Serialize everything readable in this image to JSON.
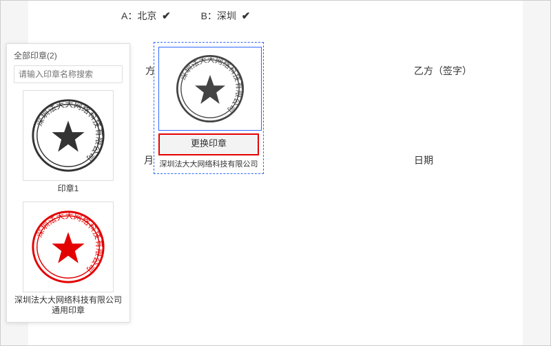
{
  "doc": {
    "optA": "A：北京",
    "optB": "B：深圳",
    "check": "✔",
    "leftMarker": "方",
    "leftDateMarker": "月",
    "partyB": "乙方（签字）",
    "dateLabel": "日期"
  },
  "sealBox": {
    "company": "深圳法大大网络科技有限公司",
    "changeLabel": "更换印章",
    "caption": "深圳法大大网络科技有限公司"
  },
  "panel": {
    "title": "全部印章",
    "count": "2",
    "searchPlaceholder": "请输入印章名称搜索",
    "items": [
      {
        "text": "深圳法大大网络科技有限公司",
        "label": "印章1",
        "color": "#333"
      },
      {
        "text": "深圳法大大网络科技有限公司",
        "label": "深圳法大大网络科技有限公司通用印章",
        "color": "#e30000"
      }
    ]
  }
}
